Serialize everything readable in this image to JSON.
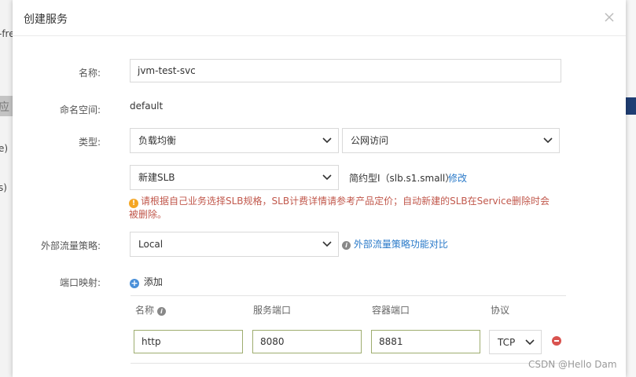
{
  "background": {
    "left_texts": [
      "-fre",
      "e)",
      "s)"
    ],
    "left_bar_text": "应"
  },
  "dialog": {
    "title": "创建服务",
    "close_glyph": "×"
  },
  "form": {
    "name": {
      "label": "名称:",
      "value": "jvm-test-svc"
    },
    "namespace": {
      "label": "命名空间:",
      "value": "default"
    },
    "type": {
      "label": "类型:",
      "select1": "负载均衡",
      "select2": "公网访问"
    },
    "slb": {
      "select": "新建SLB",
      "spec_text": "简约型I（slb.s1.small）",
      "edit_link": "修改"
    },
    "warning": "请根据自己业务选择SLB规格，SLB计费详情请参考产品定价；自动新建的SLB在Service删除时会被删除。",
    "traffic": {
      "label": "外部流量策略:",
      "value": "Local",
      "compare_link": "外部流量策略功能对比"
    },
    "ports": {
      "label": "端口映射:",
      "add_label": "添加",
      "headers": {
        "name": "名称",
        "service_port": "服务端口",
        "container_port": "容器端口",
        "protocol": "协议"
      },
      "rows": [
        {
          "name": "http",
          "service_port": "8080",
          "container_port": "8881",
          "protocol": "TCP"
        }
      ]
    }
  },
  "watermark": "CSDN @Hello Dam",
  "colors": {
    "warning": "#c1584c",
    "link": "#2a7ac9",
    "input_border_active": "#9ead6f"
  }
}
